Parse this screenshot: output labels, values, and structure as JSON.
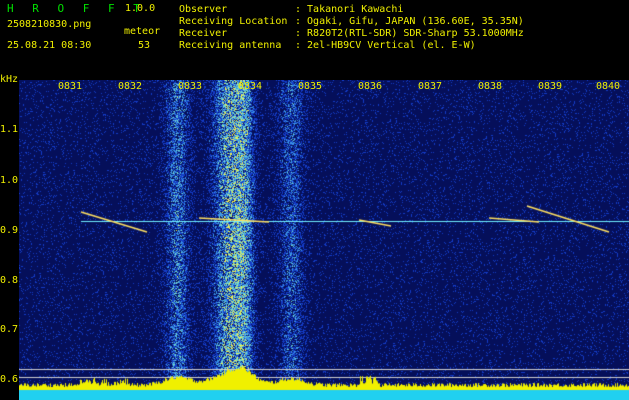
{
  "app": {
    "name": "H R O F F T",
    "version": "1.0.0"
  },
  "file": {
    "name": "2508210830.png",
    "datetime": "25.08.21 08:30"
  },
  "meteor": {
    "label": "meteor",
    "count": "53"
  },
  "info": [
    {
      "key": "Observer",
      "value": ": Takanori Kawachi"
    },
    {
      "key": "Receiving Location",
      "value": ": Ogaki, Gifu, JAPAN (136.60E, 35.35N)"
    },
    {
      "key": "Receiver",
      "value": ": R820T2(RTL-SDR) SDR-Sharp 53.1000MHz"
    },
    {
      "key": "Receiving antenna",
      "value": ": 2el-HB9CV Vertical (el. E-W)"
    }
  ],
  "time_axis": [
    "0831",
    "0832",
    "0833",
    "0834",
    "0835",
    "0836",
    "0837",
    "0838",
    "0839",
    "0840"
  ],
  "freq_axis": {
    "unit": "kHz",
    "ticks": [
      "1.1",
      "1.0",
      "0.9",
      "0.8",
      "0.7",
      "0.6"
    ]
  },
  "colors": {
    "text": "#f0f000",
    "brand": "#00e000",
    "background": "#0a1a6e",
    "bars": "#f0f000",
    "baseline": "#20d0f0"
  }
}
